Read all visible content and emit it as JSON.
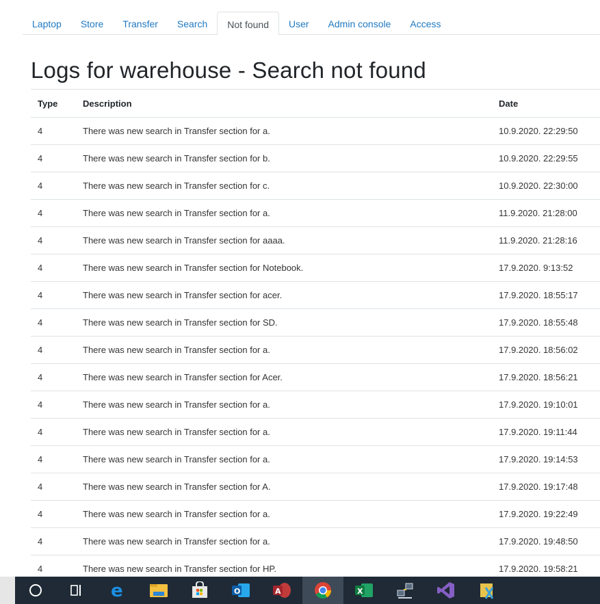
{
  "nav": {
    "tabs": [
      {
        "label": "Laptop"
      },
      {
        "label": "Store"
      },
      {
        "label": "Transfer"
      },
      {
        "label": "Search"
      },
      {
        "label": "Not found"
      },
      {
        "label": "User"
      },
      {
        "label": "Admin console"
      },
      {
        "label": "Access"
      }
    ],
    "active_tab": "Not found"
  },
  "page": {
    "title": "Logs for warehouse - Search not found"
  },
  "table": {
    "headers": {
      "type": "Type",
      "description": "Description",
      "date": "Date"
    },
    "rows": [
      {
        "type": "4",
        "description": "There was new search in Transfer section for a.",
        "date": "10.9.2020. 22:29:50"
      },
      {
        "type": "4",
        "description": "There was new search in Transfer section for b.",
        "date": "10.9.2020. 22:29:55"
      },
      {
        "type": "4",
        "description": "There was new search in Transfer section for c.",
        "date": "10.9.2020. 22:30:00"
      },
      {
        "type": "4",
        "description": "There was new search in Transfer section for a.",
        "date": "11.9.2020. 21:28:00"
      },
      {
        "type": "4",
        "description": "There was new search in Transfer section for aaaa.",
        "date": "11.9.2020. 21:28:16"
      },
      {
        "type": "4",
        "description": "There was new search in Transfer section for Notebook.",
        "date": "17.9.2020. 9:13:52"
      },
      {
        "type": "4",
        "description": "There was new search in Transfer section for acer.",
        "date": "17.9.2020. 18:55:17"
      },
      {
        "type": "4",
        "description": "There was new search in Transfer section for SD.",
        "date": "17.9.2020. 18:55:48"
      },
      {
        "type": "4",
        "description": "There was new search in Transfer section for a.",
        "date": "17.9.2020. 18:56:02"
      },
      {
        "type": "4",
        "description": "There was new search in Transfer section for Acer.",
        "date": "17.9.2020. 18:56:21"
      },
      {
        "type": "4",
        "description": "There was new search in Transfer section for a.",
        "date": "17.9.2020. 19:10:01"
      },
      {
        "type": "4",
        "description": "There was new search in Transfer section for a.",
        "date": "17.9.2020. 19:11:44"
      },
      {
        "type": "4",
        "description": "There was new search in Transfer section for a.",
        "date": "17.9.2020. 19:14:53"
      },
      {
        "type": "4",
        "description": "There was new search in Transfer section for A.",
        "date": "17.9.2020. 19:17:48"
      },
      {
        "type": "4",
        "description": "There was new search in Transfer section for a.",
        "date": "17.9.2020. 19:22:49"
      },
      {
        "type": "4",
        "description": "There was new search in Transfer section for a.",
        "date": "17.9.2020. 19:48:50"
      },
      {
        "type": "4",
        "description": "There was new search in Transfer section for HP.",
        "date": "17.9.2020. 19:58:21"
      }
    ]
  },
  "taskbar": {
    "items": [
      {
        "icon": "cortana-icon"
      },
      {
        "icon": "task-view-icon"
      },
      {
        "icon": "edge-icon"
      },
      {
        "icon": "file-explorer-icon"
      },
      {
        "icon": "microsoft-store-icon"
      },
      {
        "icon": "outlook-icon"
      },
      {
        "icon": "access-icon"
      },
      {
        "icon": "chrome-icon"
      },
      {
        "icon": "excel-icon"
      },
      {
        "icon": "network-icon"
      },
      {
        "icon": "visual-studio-icon"
      },
      {
        "icon": "vs-installer-icon"
      }
    ],
    "active_item": "chrome-icon"
  },
  "colors": {
    "link": "#1f78c1",
    "active_tab_text": "#495057",
    "border": "#dee2e6",
    "taskbar": "#1f2a36"
  }
}
